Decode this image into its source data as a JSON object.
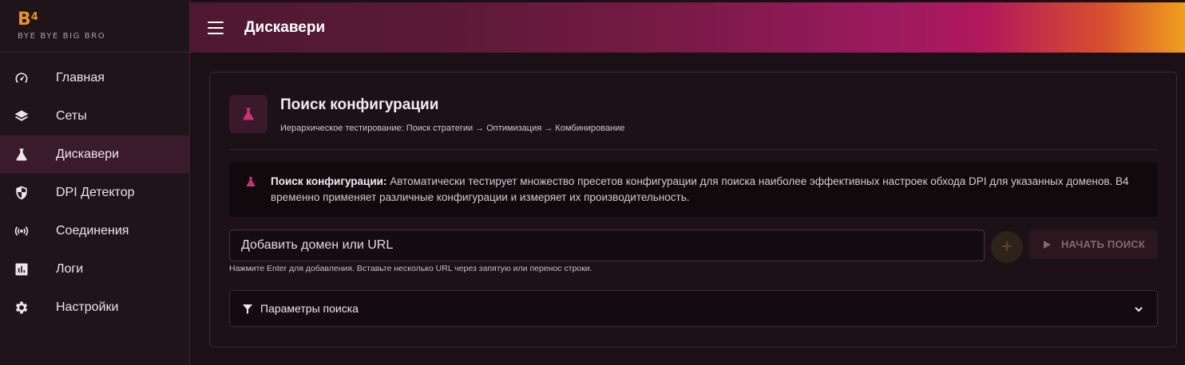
{
  "brand": {
    "logo": "B",
    "logo_sup": "4",
    "tagline": "BYE BYE BIG BRO"
  },
  "sidebar": {
    "items": [
      {
        "label": "Главная",
        "icon": "speedometer-icon",
        "active": false
      },
      {
        "label": "Сеты",
        "icon": "layers-icon",
        "active": false
      },
      {
        "label": "Дискавери",
        "icon": "flask-icon",
        "active": true
      },
      {
        "label": "DPI Детектор",
        "icon": "shield-icon",
        "active": false
      },
      {
        "label": "Соединения",
        "icon": "broadcast-icon",
        "active": false
      },
      {
        "label": "Логи",
        "icon": "bar-chart-icon",
        "active": false
      },
      {
        "label": "Настройки",
        "icon": "gear-icon",
        "active": false
      }
    ]
  },
  "header": {
    "title": "Дискавери",
    "menu_icon": "hamburger-menu-icon"
  },
  "card": {
    "title": "Поиск конфигурации",
    "subtitle": "Иерархическое тестирование: Поиск стратегии → Оптимизация → Комбинирование",
    "info_bold": "Поиск конфигурации:",
    "info_text": " Автоматически тестирует множество пресетов конфигурации для поиска наиболее эффективных настроек обхода DPI для указанных доменов. B4 временно применяет различные конфигурации и измеряет их производительность.",
    "input_placeholder": "Добавить домен или URL",
    "add_symbol": "+",
    "start_button": "НАЧАТЬ ПОИСК",
    "hint": "Нажмите Enter для добавления. Вставьте несколько URL через запятую или перенос строки.",
    "params_label": "Параметры поиска"
  },
  "colors": {
    "accent": "#c9337a",
    "brand_orange": "#e8912a",
    "active_nav": "#3a1b2c"
  }
}
